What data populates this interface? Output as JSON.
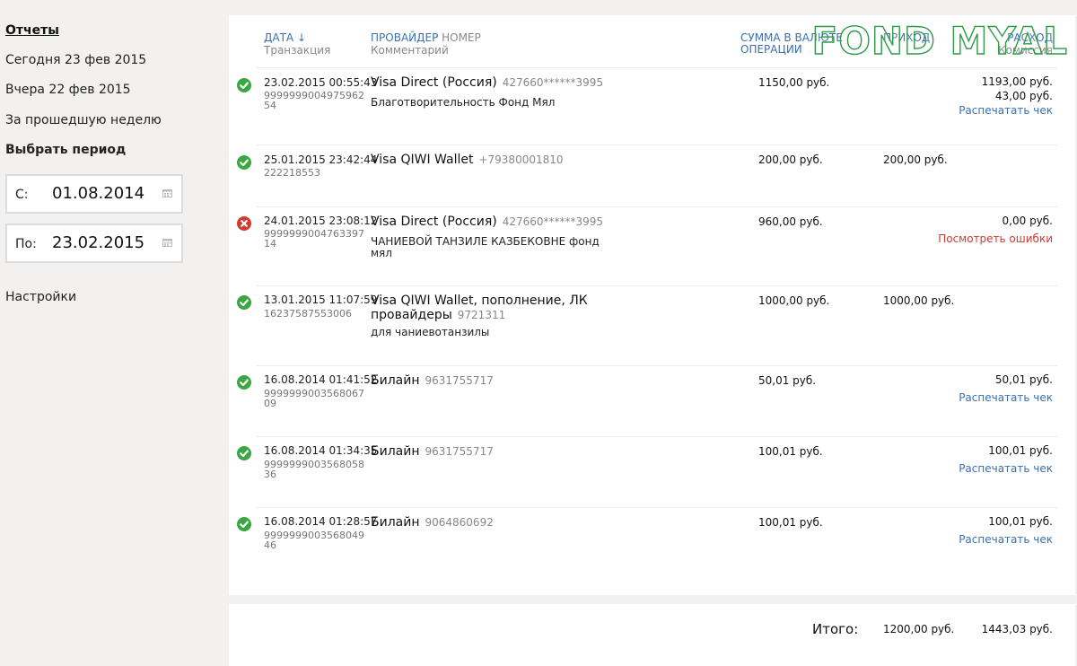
{
  "sidebar": {
    "reports": "Отчеты",
    "today": "Сегодня 23 фев 2015",
    "yesterday": "Вчера 22 фев 2015",
    "last_week": "За прошедшую неделю",
    "choose_period": "Выбрать период",
    "from_label": "С:",
    "from_value": "01.08.2014",
    "to_label": "По:",
    "to_value": "23.02.2015",
    "settings": "Настройки"
  },
  "header": {
    "date": "ДАТА ↓",
    "transaction": "Транзакция",
    "provider": "ПРОВАЙДЕР",
    "number": "НОМЕР",
    "comment": "Комментарий",
    "amount_line1": "СУММА В ВАЛЮТЕ",
    "amount_line2": "ОПЕРАЦИИ",
    "income_partial": "ПРИХОД",
    "expense_partial": "РАСХОД",
    "commission": "Комиссия"
  },
  "watermark": "FOND MYAL",
  "colors": {
    "link": "#3a6fb0",
    "success": "#3aa742",
    "error": "#d43a2f",
    "watermark": "#2f9a48"
  },
  "rows": [
    {
      "status": "success",
      "date": "23.02.2015 00:55:43",
      "txn": "999999900497596254",
      "provider": "Visa Direct (Россия)",
      "number": "427660******3995",
      "comment": "Благотворительность Фонд Мял",
      "amount": "1150,00 руб.",
      "income": "",
      "expense": "1193,00 руб.",
      "commission": "43,00 руб.",
      "action": "Распечатать чек"
    },
    {
      "status": "success",
      "date": "25.01.2015 23:42:44",
      "txn": "222218553",
      "provider": "Visa QIWI Wallet",
      "number": "+79380001810",
      "comment": "",
      "amount": "200,00 руб.",
      "income": "200,00 руб.",
      "expense": "",
      "commission": "",
      "action": ""
    },
    {
      "status": "error",
      "date": "24.01.2015 23:08:12",
      "txn": "999999900476339714",
      "provider": "Visa Direct (Россия)",
      "number": "427660******3995",
      "comment": "ЧАНИЕВОЙ ТАНЗИЛЕ КАЗБЕКОВНЕ фонд мял",
      "amount": "960,00 руб.",
      "income": "",
      "expense": "0,00 руб.",
      "commission": "",
      "action": "Посмотреть ошибки"
    },
    {
      "status": "success",
      "date": "13.01.2015 11:07:59",
      "txn": "16237587553006",
      "provider": "Visa QIWI Wallet, пополнение, ЛК провайдеры",
      "number": "9721311",
      "comment": "для чаниевотанзилы",
      "amount": "1000,00 руб.",
      "income": "1000,00 руб.",
      "expense": "",
      "commission": "",
      "action": ""
    },
    {
      "status": "success",
      "date": "16.08.2014 01:41:52",
      "txn": "999999900356806709",
      "provider": "Билайн",
      "number": "9631755717",
      "comment": "",
      "amount": "50,01 руб.",
      "income": "",
      "expense": "50,01 руб.",
      "commission": "",
      "action": "Распечатать чек"
    },
    {
      "status": "success",
      "date": "16.08.2014 01:34:35",
      "txn": "999999900356805836",
      "provider": "Билайн",
      "number": "9631755717",
      "comment": "",
      "amount": "100,01 руб.",
      "income": "",
      "expense": "100,01 руб.",
      "commission": "",
      "action": "Распечатать чек"
    },
    {
      "status": "success",
      "date": "16.08.2014 01:28:57",
      "txn": "999999900356804946",
      "provider": "Билайн",
      "number": "9064860692",
      "comment": "",
      "amount": "100,01 руб.",
      "income": "",
      "expense": "100,01 руб.",
      "commission": "",
      "action": "Распечатать чек"
    }
  ],
  "totals": {
    "label": "Итого:",
    "income": "1200,00 руб.",
    "expense": "1443,03 руб."
  }
}
